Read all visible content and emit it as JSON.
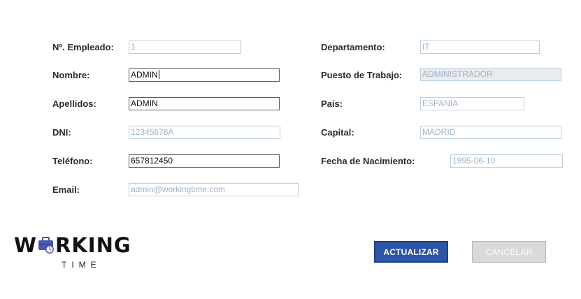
{
  "form": {
    "left": [
      {
        "key": "empleado",
        "label": "Nº. Empleado:",
        "value": "1",
        "editable": false
      },
      {
        "key": "nombre",
        "label": "Nombre:",
        "value": "ADMIN",
        "editable": true
      },
      {
        "key": "apellidos",
        "label": "Apellidos:",
        "value": "ADMIN",
        "editable": true
      },
      {
        "key": "dni",
        "label": "DNI:",
        "value": "12345678A",
        "editable": false
      },
      {
        "key": "telefono",
        "label": "Teléfono:",
        "value": "657812450",
        "editable": true
      },
      {
        "key": "email",
        "label": "Email:",
        "value": "admin@workingtime.com",
        "editable": false
      }
    ],
    "right": [
      {
        "key": "departamento",
        "label": "Departamento:",
        "value": "IT",
        "editable": false
      },
      {
        "key": "puesto",
        "label": "Puesto de Trabajo:",
        "value": "ADMINISTRADOR",
        "editable": false
      },
      {
        "key": "pais",
        "label": "País:",
        "value": "ESPANIA",
        "editable": false
      },
      {
        "key": "capital",
        "label": "Capital:",
        "value": "MADRID",
        "editable": false
      },
      {
        "key": "fecha",
        "label": "Fecha de Nacimiento:",
        "value": "1995-06-10",
        "editable": false
      }
    ]
  },
  "buttons": {
    "update_label": "ACTUALIZAR",
    "cancel_label": "CANCELAR"
  },
  "logo": {
    "word_start": "W",
    "word_end": "RKING",
    "subtitle": "TIME",
    "icon": "briefcase-clock-icon"
  },
  "colors": {
    "primary_button": "#2d55a8",
    "disabled_button": "#d9d9d9",
    "readonly_border": "#b9cfe0",
    "readonly_text": "#9fb4c6",
    "logo_icon": "#4a5ab0"
  }
}
